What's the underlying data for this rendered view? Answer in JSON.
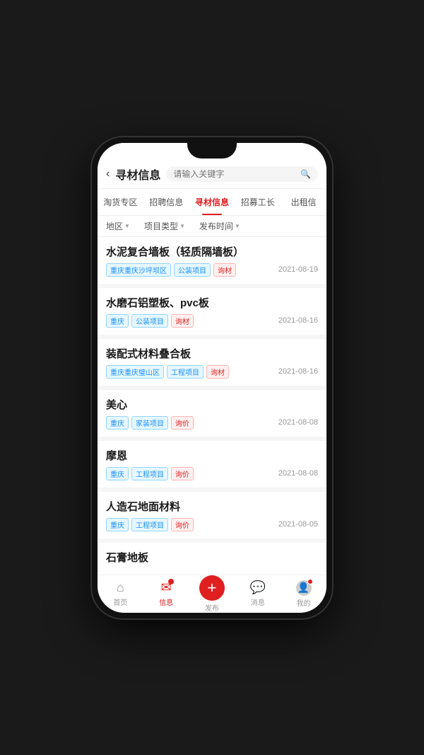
{
  "header": {
    "back_label": "‹",
    "title": "寻材信息",
    "search_placeholder": "请输入关键字"
  },
  "tabs": [
    {
      "label": "淘货专区",
      "active": false
    },
    {
      "label": "招聘信息",
      "active": false
    },
    {
      "label": "寻材信息",
      "active": true
    },
    {
      "label": "招募工长",
      "active": false
    },
    {
      "label": "出租信",
      "active": false
    }
  ],
  "filters": [
    {
      "label": "地区",
      "arrow": "▼"
    },
    {
      "label": "项目类型",
      "arrow": "▼"
    },
    {
      "label": "发布时间",
      "arrow": "▼"
    }
  ],
  "list_items": [
    {
      "title": "水泥复合墙板（轻质隔墙板）",
      "tags": [
        {
          "text": "重庆重庆沙坪坝区",
          "type": "location"
        },
        {
          "text": "公装项目",
          "type": "project"
        }
      ],
      "action": "询材",
      "date": "2021-08-19"
    },
    {
      "title": "水磨石铝塑板、pvc板",
      "tags": [
        {
          "text": "重庆",
          "type": "location"
        },
        {
          "text": "公装项目",
          "type": "project"
        }
      ],
      "action": "询材",
      "date": "2021-08-16"
    },
    {
      "title": "装配式材料叠合板",
      "tags": [
        {
          "text": "重庆重庆璧山区",
          "type": "location"
        },
        {
          "text": "工程项目",
          "type": "project"
        }
      ],
      "action": "询材",
      "date": "2021-08-16"
    },
    {
      "title": "美心",
      "tags": [
        {
          "text": "重庆",
          "type": "location"
        },
        {
          "text": "家装项目",
          "type": "project"
        }
      ],
      "action": "询价",
      "date": "2021-08-08"
    },
    {
      "title": "摩恩",
      "tags": [
        {
          "text": "重庆",
          "type": "location"
        },
        {
          "text": "工程项目",
          "type": "project"
        }
      ],
      "action": "询价",
      "date": "2021-08-08"
    },
    {
      "title": "人造石地面材料",
      "tags": [
        {
          "text": "重庆",
          "type": "location"
        },
        {
          "text": "工程项目",
          "type": "project"
        }
      ],
      "action": "询价",
      "date": "2021-08-05"
    },
    {
      "title": "石膏地板",
      "truncated": true
    }
  ],
  "bottom_nav": [
    {
      "label": "首页",
      "icon": "home",
      "active": false
    },
    {
      "label": "信息",
      "icon": "message",
      "active": true
    },
    {
      "label": "发布",
      "icon": "plus",
      "active": false,
      "is_publish": true
    },
    {
      "label": "消息",
      "icon": "chat",
      "active": false
    },
    {
      "label": "我的",
      "icon": "user",
      "active": false
    }
  ]
}
